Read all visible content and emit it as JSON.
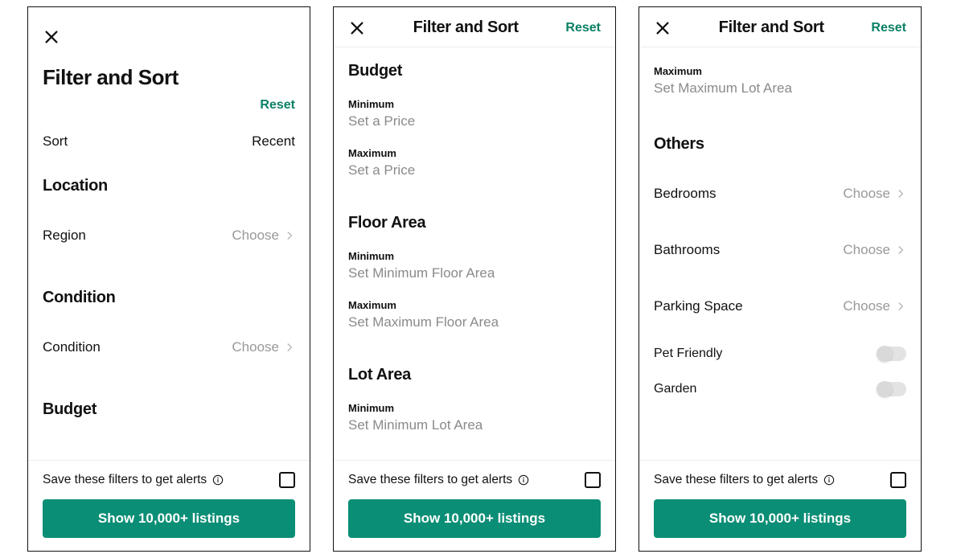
{
  "common": {
    "page_title": "Filter and Sort",
    "reset_label": "Reset",
    "save_label": "Save these filters to get alerts",
    "cta_label": "Show 10,000+ listings",
    "choose_label": "Choose"
  },
  "panel1": {
    "sort_label": "Sort",
    "sort_value": "Recent",
    "sections": {
      "location": "Location",
      "condition": "Condition",
      "budget": "Budget"
    },
    "region_label": "Region",
    "condition_label": "Condition"
  },
  "panel2": {
    "sections": {
      "budget": "Budget",
      "floor_area": "Floor Area",
      "lot_area": "Lot Area"
    },
    "budget_min_label": "Minimum",
    "budget_min_value": "Set a Price",
    "budget_max_label": "Maximum",
    "budget_max_value": "Set a Price",
    "floor_min_label": "Minimum",
    "floor_min_value": "Set Minimum Floor Area",
    "floor_max_label": "Maximum",
    "floor_max_value": "Set Maximum Floor Area",
    "lot_min_label": "Minimum",
    "lot_min_value": "Set Minimum Lot Area"
  },
  "panel3": {
    "carry_max_label": "Maximum",
    "carry_max_value": "Set Maximum Lot Area",
    "section_others": "Others",
    "bedrooms_label": "Bedrooms",
    "bathrooms_label": "Bathrooms",
    "parking_label": "Parking Space",
    "pet_label": "Pet Friendly",
    "garden_label": "Garden"
  }
}
